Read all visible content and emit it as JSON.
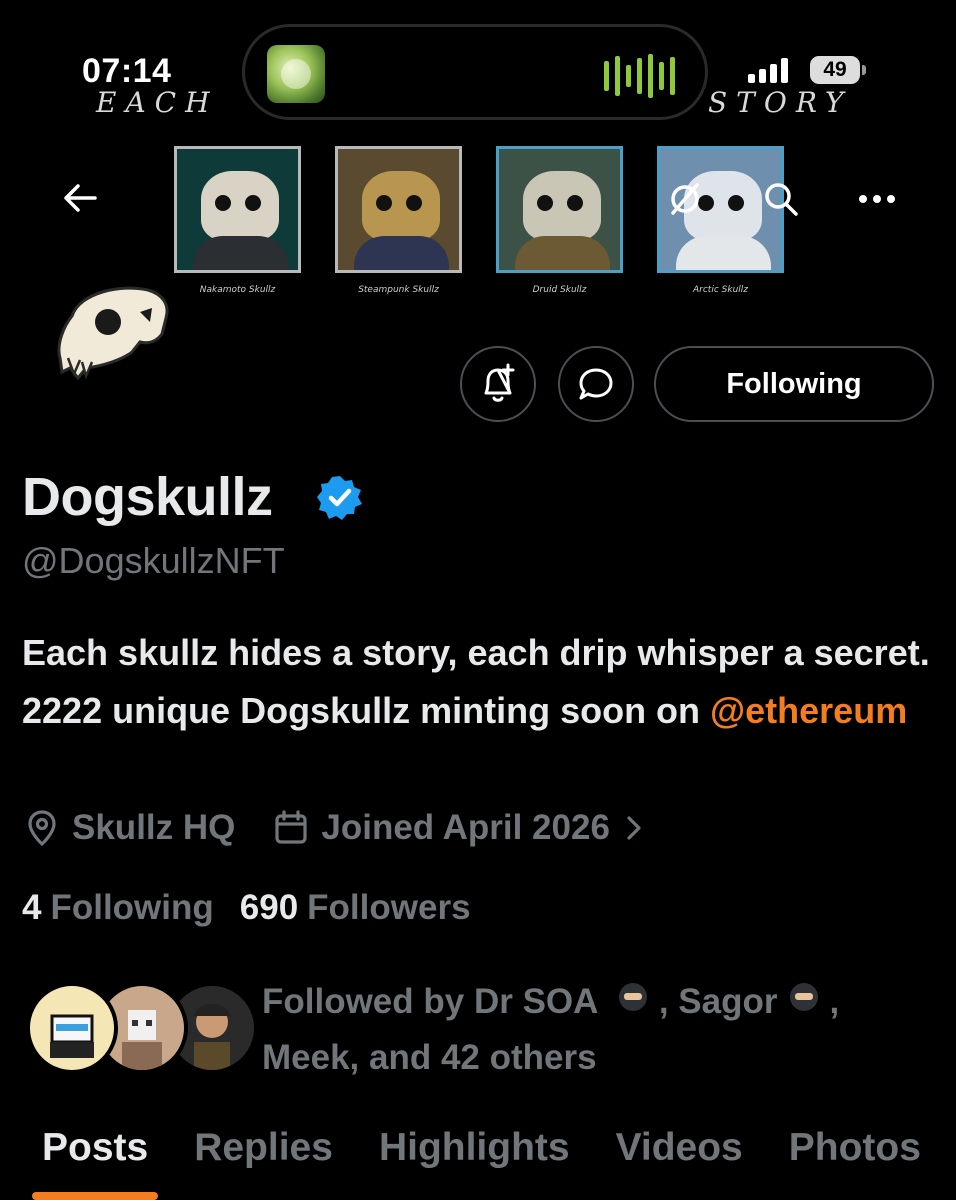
{
  "status_bar": {
    "time": "07:14",
    "battery": "49",
    "banner_word_left": "EACH",
    "banner_word_right": "STORY"
  },
  "header": {
    "back_icon": "arrow-left-icon",
    "search_icon": "search-icon",
    "more_icon": "more-horizontal-icon",
    "banner_cards": [
      {
        "caption": "Nakamoto Skullz",
        "bg": "#0f3a3a",
        "body": "#2b2f33"
      },
      {
        "caption": "Steampunk Skullz",
        "bg": "#5a4a30",
        "body": "#2d3552"
      },
      {
        "caption": "Druid Skullz",
        "bg": "#3c5246",
        "body": "#6b5a34"
      },
      {
        "caption": "Arctic Skullz",
        "bg": "#6f8fae",
        "body": "#e3e7ea"
      }
    ]
  },
  "profile": {
    "display_name": "Dogskullz",
    "handle": "@DogskullzNFT",
    "bio_text": "Each skullz hides a story, each drip whisper a secret. 2222 unique Dogskullz minting soon on ",
    "bio_mention": "@ethereum",
    "location": "Skullz HQ",
    "joined": "Joined April 2026",
    "following_count": "4",
    "following_label": "Following",
    "followers_count": "690",
    "followers_label": "Followers",
    "followed_by_prefix": "Followed by Dr SOA",
    "followed_by_middle": ", Sagor",
    "followed_by_suffix": ",",
    "followed_by_line2": "Meek, and 42 others"
  },
  "actions": {
    "notify_icon": "bell-plus-icon",
    "message_icon": "message-bubble-icon",
    "following_button": "Following"
  },
  "tabs": [
    {
      "label": "Posts",
      "active": true
    },
    {
      "label": "Replies",
      "active": false
    },
    {
      "label": "Highlights",
      "active": false
    },
    {
      "label": "Videos",
      "active": false
    },
    {
      "label": "Photos",
      "active": false
    }
  ],
  "colors": {
    "accent": "#f47d20",
    "verified": "#1d9bf0",
    "muted_text": "#71767b"
  }
}
